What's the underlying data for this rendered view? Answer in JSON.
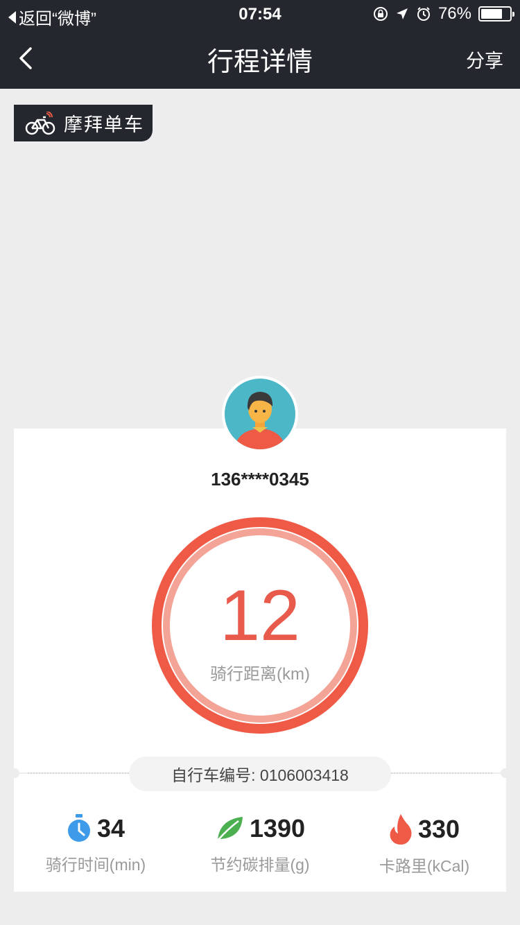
{
  "status_bar": {
    "back_app": "返回“微博”",
    "time": "07:54",
    "battery_text": "76%",
    "battery_level": 0.76
  },
  "nav": {
    "title": "行程详情",
    "share": "分享"
  },
  "brand": {
    "name": "摩拜单车"
  },
  "user": {
    "phone": "136****0345"
  },
  "trip": {
    "distance_value": "12",
    "distance_label": "骑行距离(km)",
    "bike_id": "自行车编号: 0106003418"
  },
  "stats": [
    {
      "icon": "stopwatch-icon",
      "value": "34",
      "label": "骑行时间(min)",
      "color": "#3d9be9"
    },
    {
      "icon": "leaf-icon",
      "value": "1390",
      "label": "节约碳排量(g)",
      "color": "#4caf50"
    },
    {
      "icon": "flame-icon",
      "value": "330",
      "label": "卡路里(kCal)",
      "color": "#ef5a46"
    }
  ],
  "colors": {
    "header_bg": "#24272e",
    "accent_red": "#e85a4b",
    "page_bg": "#ededed"
  }
}
